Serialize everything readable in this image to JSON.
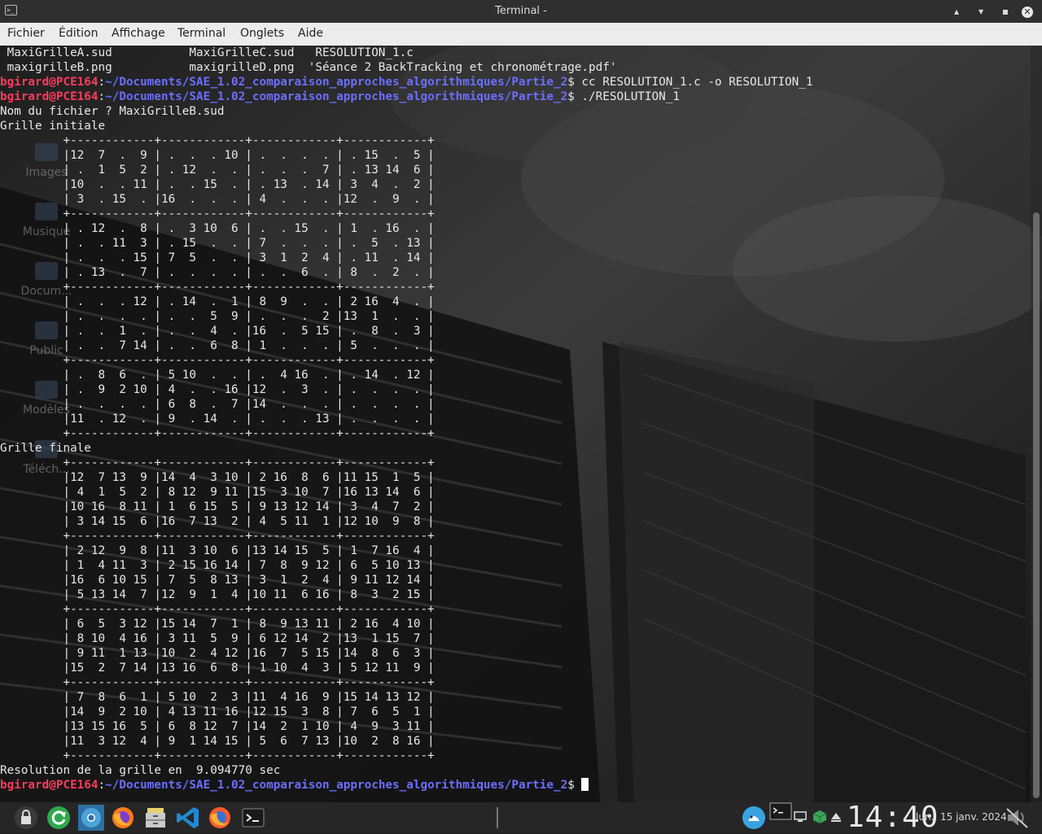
{
  "window": {
    "title": "Terminal -",
    "buttons": {
      "minimize": "▴",
      "maximize": "▾",
      "restore": "▪",
      "close": "✕"
    }
  },
  "menu": [
    "Fichier",
    "Édition",
    "Affichage",
    "Terminal",
    "Onglets",
    "Aide"
  ],
  "prompt": {
    "user": "bgirard@PCE164",
    "sep": ":",
    "path": "~/Documents/SAE_1.02_comparaison_approches_algorithmiques/Partie_2",
    "symbol": "$"
  },
  "terminal": {
    "ls_line1": " MaxiGrilleA.sud           MaxiGrilleC.sud   RESOLUTION_1.c",
    "ls_line2": " maxigrilleB.png           maxigrilleD.png  'Séance 2 BackTracking et chronométrage.pdf'",
    "cmd1": " cc RESOLUTION_1.c -o RESOLUTION_1",
    "cmd2": " ./RESOLUTION_1",
    "prompt_name": "Nom du fichier ? MaxiGrilleB.sud",
    "initial_label": "Grille initiale",
    "initial_grid": [
      "         +------------+------------+------------+------------+",
      "         |12  7  .  9 | .  .  . 10 | .  .  .  . | . 15  .  5 |",
      "         | .  1  5  2 | . 12  .  . | .  .  .  7 | . 13 14  6 |",
      "         |10  .  . 11 | .  . 15  . | . 13  . 14 | 3  4  .  2 |",
      "         | 3  . 15  . |16  .  .  . | 4  .  .  . |12  .  9  . |",
      "         +------------+------------+------------+------------+",
      "         | . 12  .  8 | .  3 10  6 | .  . 15  . | 1  . 16  . |",
      "         | .  . 11  3 | . 15  .  . | 7  .  .  . | .  5  . 13 |",
      "         | .  .  . 15 | 7  5  .  . | 3  1  2  4 | . 11  . 14 |",
      "         | . 13  .  7 | .  .  .  . | .  .  6  . | 8  .  2  . |",
      "         +------------+------------+------------+------------+",
      "         | .  .  . 12 | . 14  .  1 | 8  9  .  . | 2 16  4  . |",
      "         | .  .  .  . | .  .  5  9 | .  .  .  2 |13  1  .  . |",
      "         | .  .  1  . | .  .  4  . |16  .  5 15 | .  8  .  3 |",
      "         | .  .  7 14 | .  .  6  8 | 1  .  .  . | 5  .  .  . |",
      "         +------------+------------+------------+------------+",
      "         | .  8  6  . | 5 10  .  . | .  4 16  . | . 14  . 12 |",
      "         | .  9  2 10 | 4  .  . 16 |12  .  3  . | .  .  .  . |",
      "         | .  .  .  . | 6  8  .  7 |14  .  .  . | .  .  .  . |",
      "         |11  . 12  . | 9  . 14  . | .  .  . 13 | .  .  .  . |",
      "         +------------+------------+------------+------------+"
    ],
    "final_label": "Grille finale",
    "final_grid": [
      "         +------------+------------+------------+------------+",
      "         |12  7 13  9 |14  4  3 10 | 2 16  8  6 |11 15  1  5 |",
      "         | 4  1  5  2 | 8 12  9 11 |15  3 10  7 |16 13 14  6 |",
      "         |10 16  8 11 | 1  6 15  5 | 9 13 12 14 | 3  4  7  2 |",
      "         | 3 14 15  6 |16  7 13  2 | 4  5 11  1 |12 10  9  8 |",
      "         +------------+------------+------------+------------+",
      "         | 2 12  9  8 |11  3 10  6 |13 14 15  5 | 1  7 16  4 |",
      "         | 1  4 11  3 | 2 15 16 14 | 7  8  9 12 | 6  5 10 13 |",
      "         |16  6 10 15 | 7  5  8 13 | 3  1  2  4 | 9 11 12 14 |",
      "         | 5 13 14  7 |12  9  1  4 |10 11  6 16 | 8  3  2 15 |",
      "         +------------+------------+------------+------------+",
      "         | 6  5  3 12 |15 14  7  1 | 8  9 13 11 | 2 16  4 10 |",
      "         | 8 10  4 16 | 3 11  5  9 | 6 12 14  2 |13  1 15  7 |",
      "         | 9 11  1 13 |10  2  4 12 |16  7  5 15 |14  8  6  3 |",
      "         |15  2  7 14 |13 16  6  8 | 1 10  4  3 | 5 12 11  9 |",
      "         +------------+------------+------------+------------+",
      "         | 7  8  6  1 | 5 10  2  3 |11  4 16  9 |15 14 13 12 |",
      "         |14  9  2 10 | 4 13 11 16 |12 15  3  8 | 7  6  5  1 |",
      "         |13 15 16  5 | 6  8 12  7 |14  2  1 10 | 4  9  3 11 |",
      "         |11  3 12  4 | 9  1 14 15 | 5  6  7 13 |10  2  8 16 |",
      "         +------------+------------+------------+------------+"
    ],
    "result": "Resolution de la grille en  9.094770 sec"
  },
  "desktop_icons": [
    "Images",
    "Musique",
    "Docum...",
    "Public",
    "Modèles",
    "Téléch..."
  ],
  "taskbar": {
    "apps": [
      "lock-icon",
      "refresh-icon",
      "chromium-icon",
      "firefox-icon",
      "file-manager-icon",
      "vscode-icon",
      "firefox-dev-icon",
      "terminal-icon"
    ],
    "clock": "14:40",
    "date": "lun., 15 janv. 2024"
  }
}
